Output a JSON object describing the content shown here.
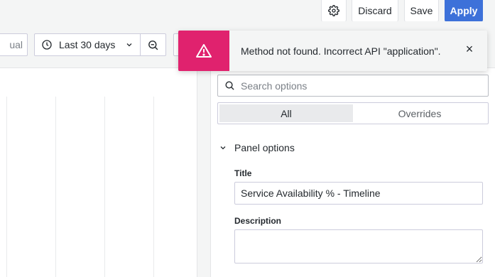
{
  "header": {
    "discard_label": "Discard",
    "save_label": "Save",
    "apply_label": "Apply",
    "apply_color": "#3d71d9"
  },
  "toolbar": {
    "viz_toggle_partial": "ual",
    "time_range": "Last 30 days"
  },
  "toast": {
    "message": "Method not found. Incorrect API \"application\".",
    "close_glyph": "×",
    "accent_color": "#e0226e"
  },
  "options": {
    "search_placeholder": "Search options",
    "tabs": [
      {
        "label": "All"
      },
      {
        "label": "Overrides"
      }
    ],
    "section_title": "Panel options",
    "title_label": "Title",
    "title_value": "Service Availability % - Timeline",
    "description_label": "Description",
    "description_value": ""
  },
  "icons": {
    "gear": "gear-icon",
    "clock": "clock-icon",
    "chevron": "chevron-down-icon",
    "zoom_out": "zoom-out-icon",
    "warning": "warning-icon",
    "search": "search-icon",
    "close": "close-icon"
  }
}
